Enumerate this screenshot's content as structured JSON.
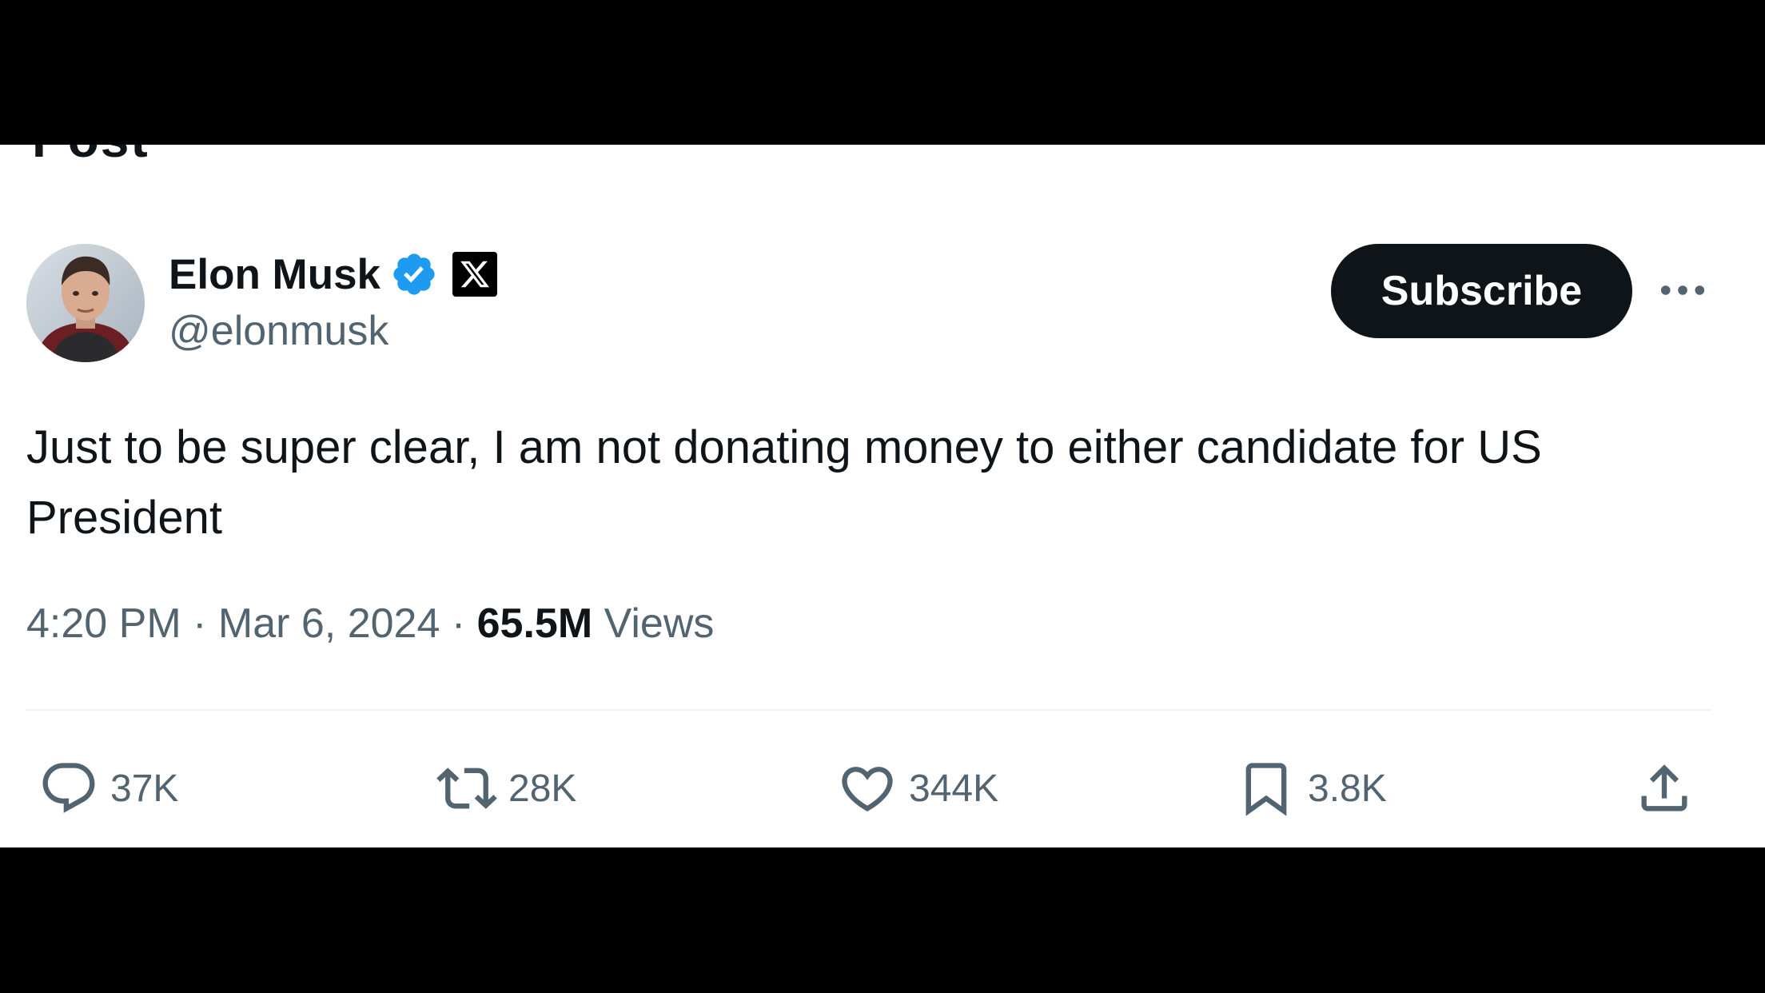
{
  "header": {
    "title": "Post"
  },
  "author": {
    "name": "Elon Musk",
    "handle": "@elonmusk",
    "verified_color": "#1d9bf0",
    "affiliate_badge": "X"
  },
  "subscribe_label": "Subscribe",
  "tweet": {
    "text": "Just to be super clear, I am not donating money to either candidate for US President",
    "time": "4:20 PM",
    "separator": "·",
    "date": "Mar 6, 2024",
    "views_count": "65.5M",
    "views_label": "Views"
  },
  "actions": {
    "replies": "37K",
    "reposts": "28K",
    "likes": "344K",
    "bookmarks": "3.8K"
  },
  "colors": {
    "text_primary": "#0f1419",
    "text_secondary": "#536471",
    "accent": "#1d9bf0",
    "divider": "#eff3f4"
  }
}
